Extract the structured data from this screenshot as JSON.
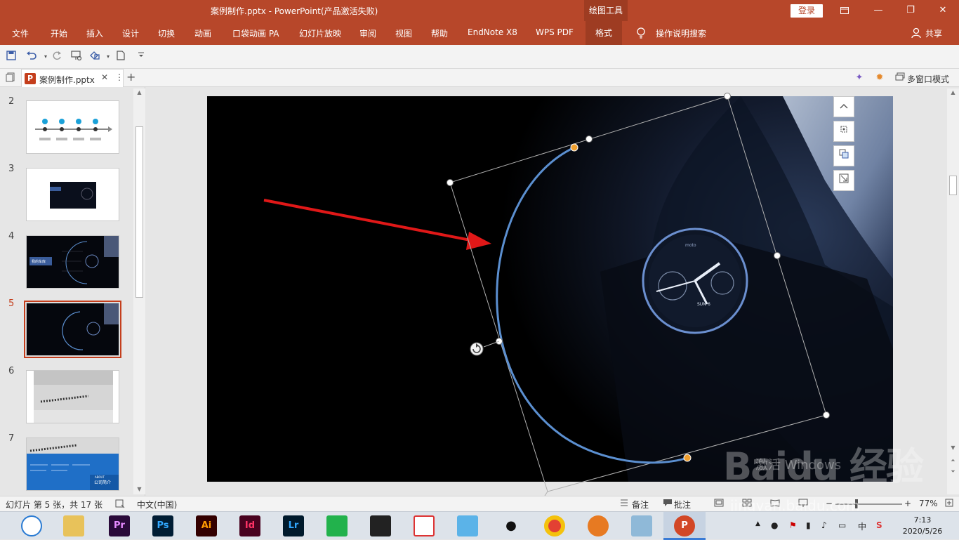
{
  "titlebar": {
    "title": "案例制作.pptx  -  PowerPoint(产品激活失败)",
    "context_group": "绘图工具",
    "login": "登录",
    "ribbon_display_icon": "ribbon-display-icon",
    "minimize": "—",
    "restore": "❐",
    "close": "✕"
  },
  "ribbon": {
    "tabs": [
      "文件",
      "开始",
      "插入",
      "设计",
      "切换",
      "动画",
      "口袋动画 PA",
      "幻灯片放映",
      "审阅",
      "视图",
      "帮助",
      "EndNote X8",
      "WPS PDF",
      "格式"
    ],
    "active_tab": "格式",
    "search": "操作说明搜索",
    "share": "共享"
  },
  "quick_access": {
    "save": "save-icon",
    "undo": "undo-icon",
    "redo": "redo-icon",
    "present": "present-icon",
    "shape": "shape-icon",
    "new": "new-doc-icon",
    "customize": "customize-icon"
  },
  "doc_tabs": {
    "file_name": "案例制作.pptx",
    "close_symbol": "✕",
    "more_symbol": "⋮",
    "add_symbol": "+",
    "multi_window": "多窗口模式",
    "file_icon_letter": "P"
  },
  "thumbnails": [
    {
      "number": "2"
    },
    {
      "number": "3"
    },
    {
      "number": "4"
    },
    {
      "number": "5",
      "selected": true
    },
    {
      "number": "6"
    },
    {
      "number": "7"
    }
  ],
  "thumb_texts": {
    "slide4_label": "我的车库",
    "slide7_title": "公司简介",
    "slide7_sub": "ABOUT"
  },
  "slide_watch_text": {
    "brand": "moto",
    "day": "SUN",
    "date": "6"
  },
  "float_buttons": [
    "chevron-up-icon",
    "position-icon",
    "arrange-icon",
    "resize-icon"
  ],
  "status": {
    "slide_info": "幻灯片 第 5 张，共 17 张",
    "language": "中文(中国)",
    "notes": "备注",
    "comments": "批注",
    "zoom": "77%",
    "zoom_minus": "−",
    "zoom_plus": "+"
  },
  "watermark": {
    "line1": "激活 Windows",
    "brand": "Baidu 经验",
    "url": "jingyan.baidu.com"
  },
  "taskbar": {
    "apps": [
      "Pr",
      "Ps",
      "Ai",
      "Id",
      "Lr"
    ],
    "ime": "中",
    "time": "7:13",
    "date": "2020/5/26"
  },
  "colors": {
    "accent": "#b7472a",
    "arc": "#5b8fd0",
    "handle_orange": "#f0a030",
    "arrow": "#e01818"
  }
}
